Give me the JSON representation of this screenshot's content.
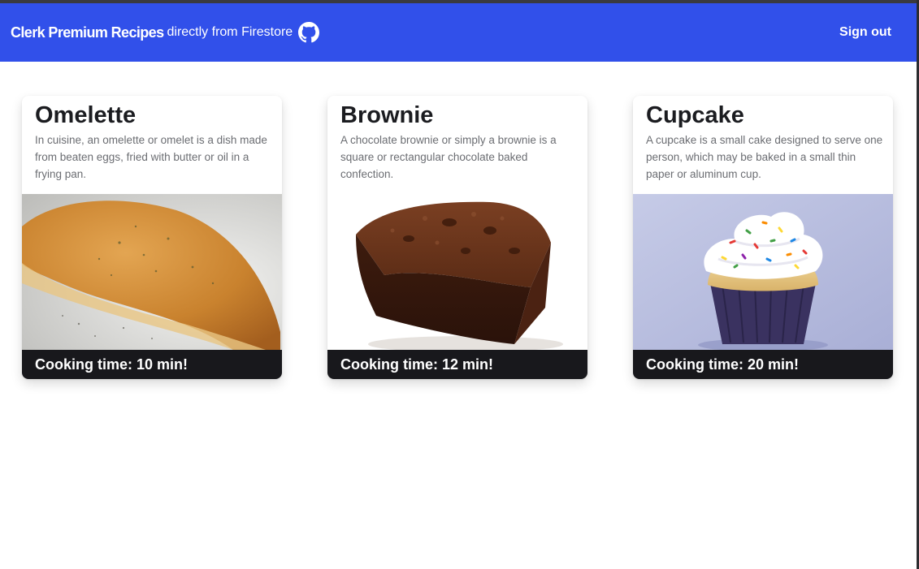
{
  "header": {
    "title": "Clerk Premium Recipes",
    "subtitle": "directly from Firestore",
    "github_icon": "github-icon",
    "sign_out": "Sign out",
    "color": "#3150ea"
  },
  "recipes": [
    {
      "name": "Omelette",
      "description": "In cuisine, an omelette or omelet is a dish made from beaten eggs, fried with butter or oil in a frying pan.",
      "cooking_time": "Cooking time: 10 min!"
    },
    {
      "name": "Brownie",
      "description": "A chocolate brownie or simply a brownie is a square or rectangular chocolate baked confection.",
      "cooking_time": "Cooking time: 12 min!"
    },
    {
      "name": "Cupcake",
      "description": "A cupcake is a small cake designed to serve one person, which may be baked in a small thin paper or aluminum cup.",
      "cooking_time": "Cooking time: 20 min!"
    }
  ]
}
